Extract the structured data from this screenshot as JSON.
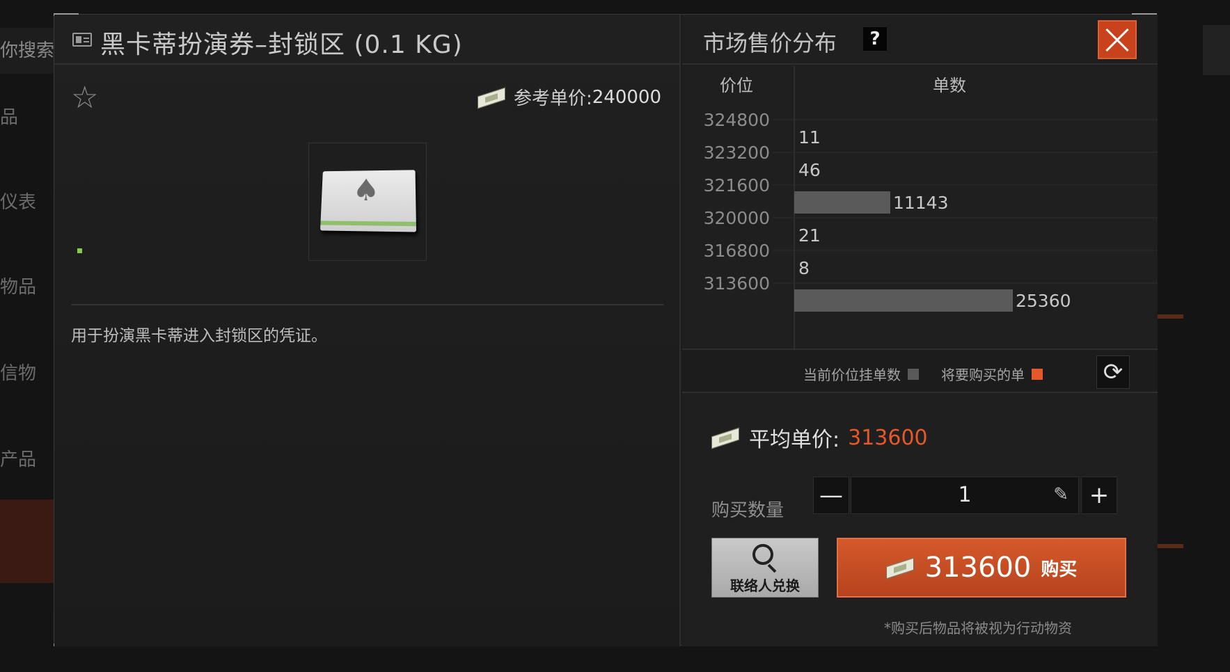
{
  "background": {
    "search_text": "你搜索",
    "side_items": [
      "品",
      "仪表",
      "物品",
      "信物",
      "产品"
    ]
  },
  "item": {
    "title": "黑卡蒂扮演券–封锁区 (0.1 KG)",
    "ref_price_label": "参考单价:",
    "ref_price_value": "240000",
    "description": "用于扮演黑卡蒂进入封锁区的凭证。",
    "icon": "id-card-icon"
  },
  "market": {
    "title": "市场售价分布",
    "help_label": "?",
    "price_header": "价位",
    "count_header": "单数",
    "legend_current": "当前价位挂单数",
    "legend_buy": "将要购买的单",
    "colors": {
      "current": "#5a5a5a",
      "buy": "#e4582a",
      "accent": "#c8431c"
    }
  },
  "chart_data": {
    "type": "bar",
    "orientation": "horizontal",
    "categories": [
      "324800",
      "323200",
      "321600",
      "320000",
      "316800",
      "313600"
    ],
    "values": [
      11,
      46,
      11143,
      21,
      8,
      25360
    ],
    "xlabel": "单数",
    "ylabel": "价位"
  },
  "purchase": {
    "avg_label": "平均单价:",
    "avg_value": "313600",
    "qty_label": "购买数量",
    "qty_value": "1",
    "minus": "—",
    "plus": "+",
    "contact_label": "联络人兑换",
    "buy_price": "313600",
    "buy_text": "购买",
    "note": "*购买后物品将被视为行动物资"
  }
}
